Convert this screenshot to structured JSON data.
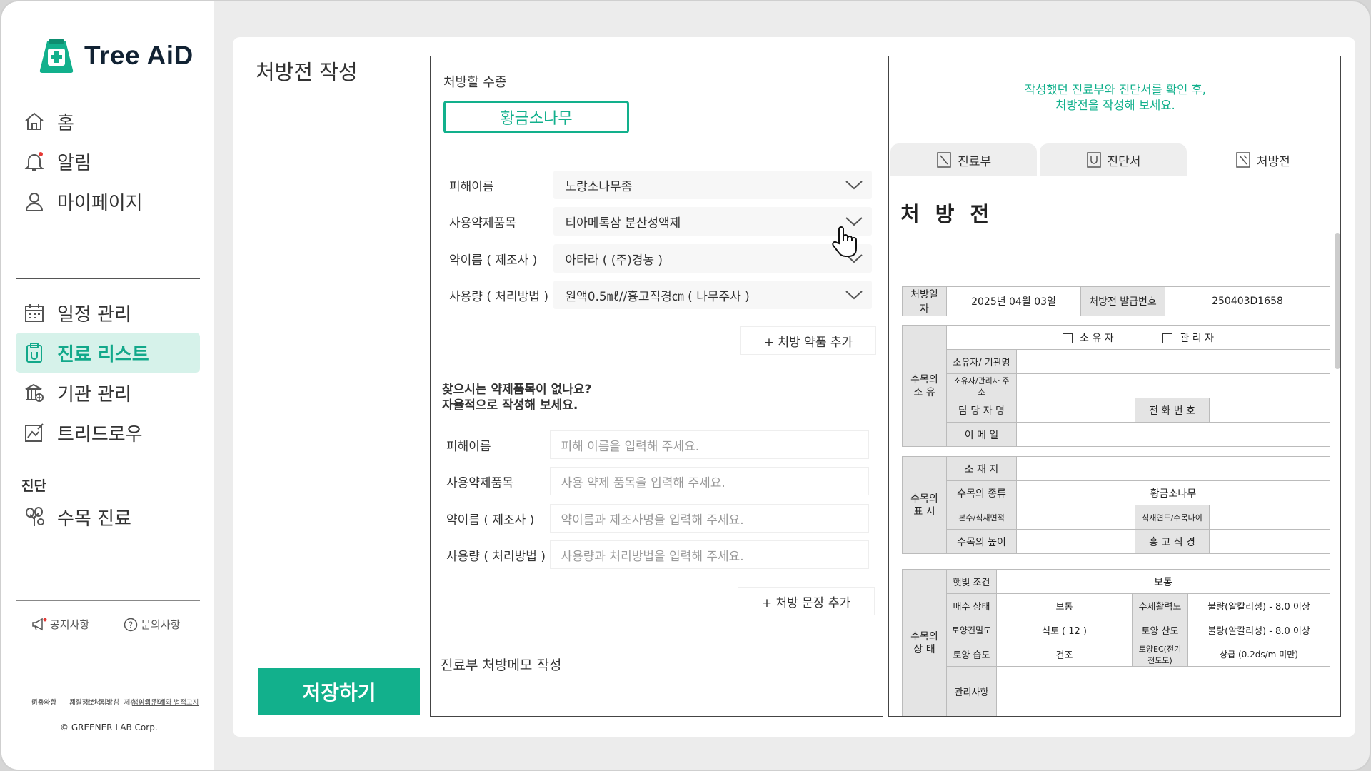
{
  "app": {
    "name": "Tree AiD"
  },
  "sidebar": {
    "top_items": [
      {
        "label": "홈",
        "icon": "home-icon"
      },
      {
        "label": "알림",
        "icon": "bell-icon"
      },
      {
        "label": "마이페이지",
        "icon": "user-icon"
      }
    ],
    "menu_items": [
      {
        "label": "일정 관리",
        "icon": "calendar-icon"
      },
      {
        "label": "진료 리스트",
        "icon": "clipboard-icon",
        "active": true
      },
      {
        "label": "기관 관리",
        "icon": "institution-icon"
      },
      {
        "label": "트리드로우",
        "icon": "drawing-icon"
      }
    ],
    "section_label": "진단",
    "diagnosis_items": [
      {
        "label": "수목 진료",
        "icon": "tree-icon"
      }
    ],
    "bottom_links": {
      "notice": "공지사항",
      "inquiry": "문의사항"
    },
    "footer": {
      "row1": [
        "이용약관",
        "개인정보처리방침",
        "책임의 한계와 법적고지"
      ],
      "row2": [
        "준수사항",
        "품질 개선 동의",
        "제휴·이용문의"
      ],
      "copyright": "© GREENER LAB Corp."
    }
  },
  "page": {
    "title": "처방전 작성",
    "save_label": "저장하기"
  },
  "form": {
    "species_label": "처방할 수종",
    "species_value": "황금소나무",
    "select_rows": [
      {
        "label": "피해이름",
        "value": "노랑소나무좀"
      },
      {
        "label": "사용약제품목",
        "value": "티아메톡삼 분산성액제"
      },
      {
        "label": "약이름 ( 제조사 )",
        "value": "아타라 ( (주)경농 )"
      },
      {
        "label": "사용량 ( 처리방법 )",
        "value": "원액0.5㎖//흉고직경㎝ ( 나무주사 )"
      }
    ],
    "add_drug_label": "+ 처방 약품 추가",
    "hint_line1": "찾으시는 약제품목이 없나요?",
    "hint_line2": "자율적으로 작성해 보세요.",
    "input_rows": [
      {
        "label": "피해이름",
        "placeholder": "피해 이름을 입력해 주세요."
      },
      {
        "label": "사용약제품목",
        "placeholder": "사용 약제 품목을 입력해 주세요."
      },
      {
        "label": "약이름 ( 제조사 )",
        "placeholder": "약이름과 제조사명을 입력해 주세요."
      },
      {
        "label": "사용량 ( 처리방법 )",
        "placeholder": "사용량과 처리방법을 입력해 주세요."
      }
    ],
    "add_sentence_label": "+ 처방 문장 추가",
    "memo_label": "진료부 처방메모 작성"
  },
  "doc": {
    "note_line1": "작성했던 진료부와 진단서를 확인 후,",
    "note_line2": "처방전을 작성해 보세요.",
    "tabs": [
      {
        "label": "진료부",
        "icon": "chart-doc-icon"
      },
      {
        "label": "진단서",
        "icon": "diagnosis-doc-icon"
      },
      {
        "label": "처방전",
        "icon": "prescription-doc-icon",
        "active": true
      }
    ],
    "title": "처 방 전",
    "header": {
      "date_label": "처방일자",
      "date_value": "2025년 04월 03일",
      "no_label": "처방전 발급번호",
      "no_value": "250403D1658"
    },
    "owner": {
      "section": "수목의\n소 유",
      "owner_check": "소 유 자",
      "manager_check": "관 리 자",
      "org_label": "소유자/ 기관명",
      "address_label": "소유자/관리자 주소",
      "person_label": "담 당 자 명",
      "phone_label": "전 화 번 호",
      "email_label": "이 메 일"
    },
    "tree": {
      "section": "수목의\n표 시",
      "location_label": "소 재 지",
      "species_label": "수목의 종류",
      "species_value": "황금소나무",
      "count_label": "본수/식재면적",
      "year_label": "식재연도/수목나이",
      "height_label": "수목의 높이",
      "dbh_label": "흉 고 직 경"
    },
    "state": {
      "section": "수목의\n상 태",
      "sun_label": "햇빛 조건",
      "sun_value": "보통",
      "drain_label": "배수 상태",
      "drain_value": "보통",
      "vigor_label": "수세활력도",
      "vigor_value": "불량(알칼리성) - 8.0 이상",
      "hardness_label": "토양견밀도",
      "hardness_value": "식토 ( 12 )",
      "ph_label": "토양 산도",
      "ph_value": "불량(알칼리성) - 8.0 이상",
      "moisture_label": "토양 습도",
      "moisture_value": "건조",
      "ec_label": "토양EC(전기전도도)",
      "ec_value": "상급 (0.2ds/m 미만)",
      "manage_label": "관리사항"
    }
  },
  "colors": {
    "accent": "#12b08c",
    "active_bg": "#d6f2ea"
  }
}
